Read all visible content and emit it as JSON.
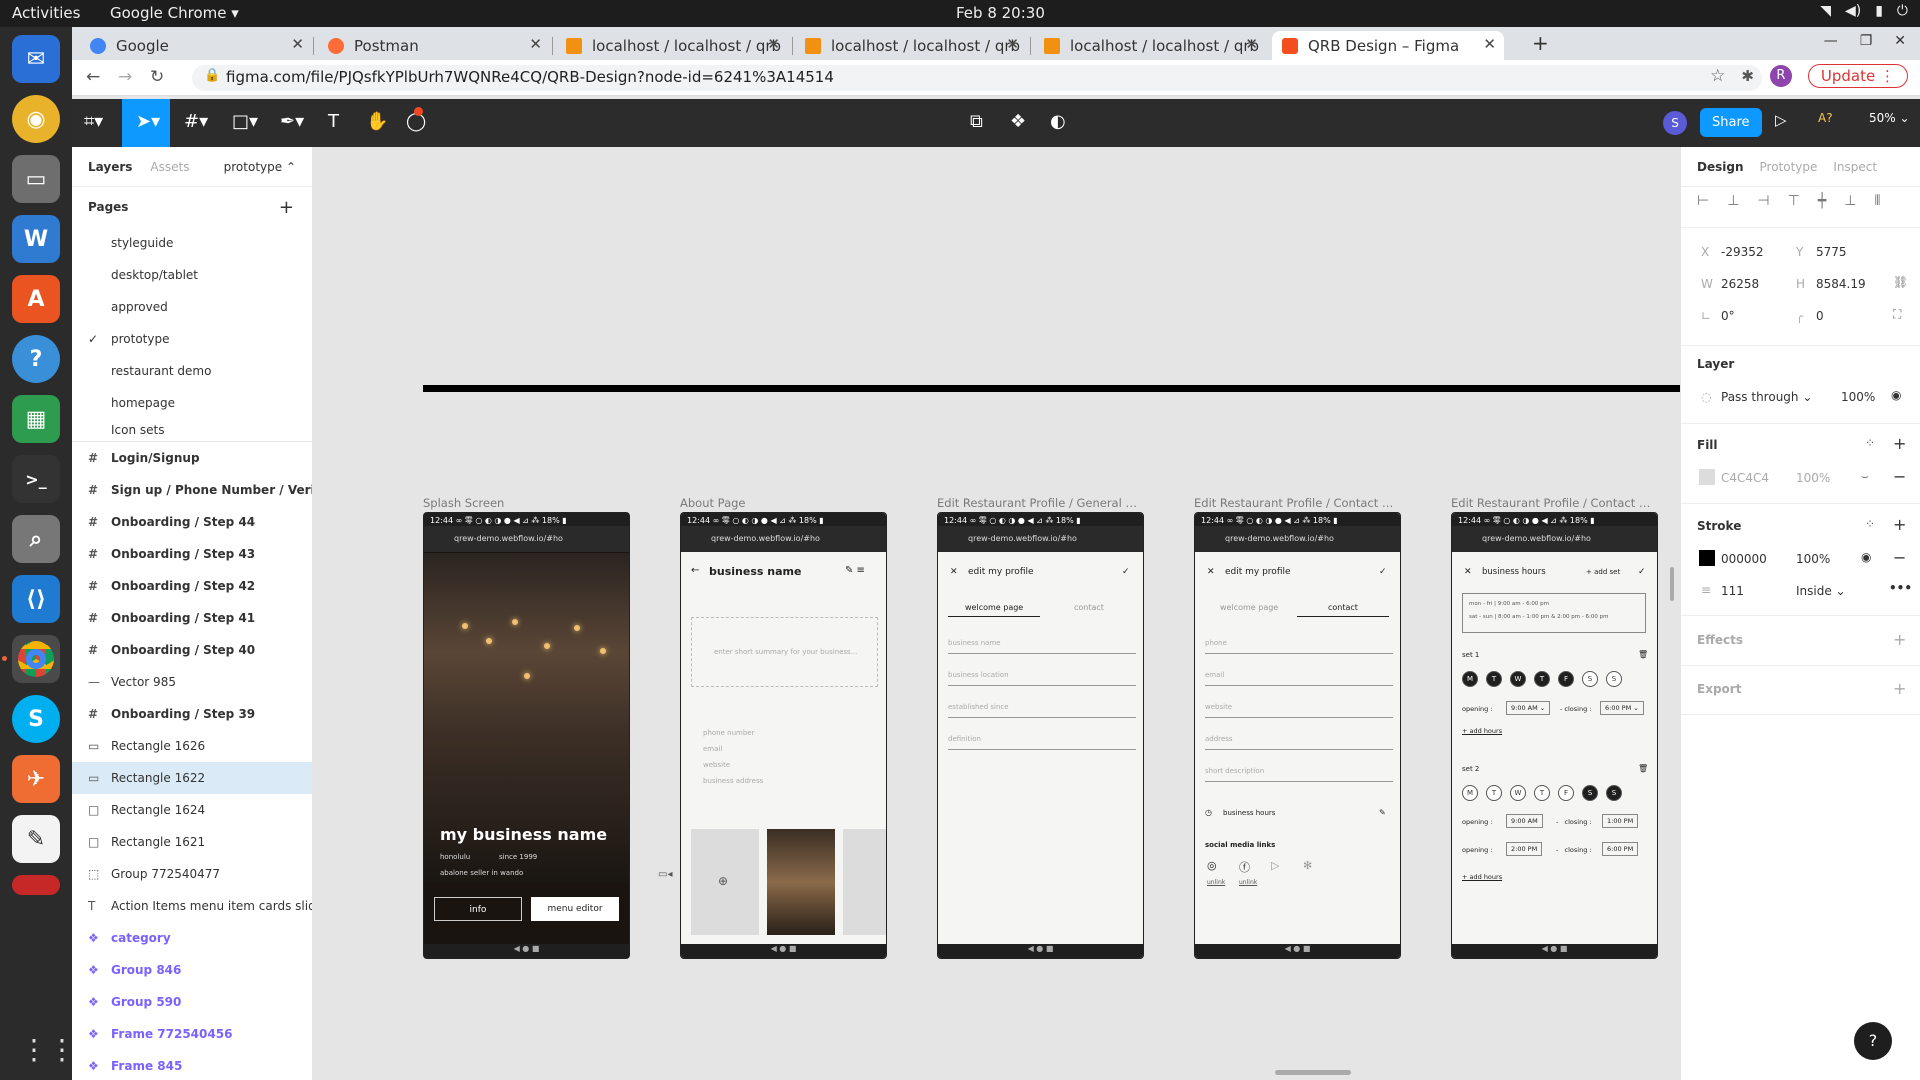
{
  "topbar": {
    "activities": "Activities",
    "app": "Google Chrome ▾",
    "clock": "Feb 8  20:30"
  },
  "tabs": [
    {
      "label": "Google",
      "color": "#4285f4"
    },
    {
      "label": "Postman",
      "color": "#ff6c37"
    },
    {
      "label": "localhost / localhost / qrb",
      "color": "#f29111"
    },
    {
      "label": "localhost / localhost / qrb",
      "color": "#f29111"
    },
    {
      "label": "localhost / localhost / qrb",
      "color": "#f29111"
    },
    {
      "label": "QRB Design – Figma",
      "color": "#f24e1e"
    }
  ],
  "address": {
    "url": "figma.com/file/PJQsfkYPlbUrh7WQNRe4CQ/QRB-Design?node-id=6241%3A14514",
    "update": "Update",
    "avatar": "R"
  },
  "figma": {
    "share": "Share",
    "zoom": "50%",
    "avatar": "S",
    "missing_fonts": "A?"
  },
  "left": {
    "tab_layers": "Layers",
    "tab_assets": "Assets",
    "page_picker": "prototype ⌃",
    "pages_title": "Pages",
    "pages": [
      "styleguide",
      "desktop/tablet",
      "approved",
      "prototype",
      "restaurant demo",
      "homepage",
      "Icon sets"
    ],
    "layers": [
      {
        "name": "Login/Signup",
        "type": "frame"
      },
      {
        "name": "Sign up / Phone Number / Verify",
        "type": "frame"
      },
      {
        "name": "Onboarding / Step 44",
        "type": "frame"
      },
      {
        "name": "Onboarding / Step 43",
        "type": "frame"
      },
      {
        "name": "Onboarding / Step 42",
        "type": "frame"
      },
      {
        "name": "Onboarding / Step 41",
        "type": "frame"
      },
      {
        "name": "Onboarding / Step 40",
        "type": "frame"
      },
      {
        "name": "Vector 985",
        "type": "vector"
      },
      {
        "name": "Onboarding / Step 39",
        "type": "frame"
      },
      {
        "name": "Rectangle 1626",
        "type": "rect"
      },
      {
        "name": "Rectangle 1622",
        "type": "rect"
      },
      {
        "name": "Rectangle 1624",
        "type": "rect"
      },
      {
        "name": "Rectangle 1621",
        "type": "rect"
      },
      {
        "name": "Group 772540477",
        "type": "group"
      },
      {
        "name": "Action Items menu item cards slidi...",
        "type": "text"
      },
      {
        "name": "category",
        "type": "comp"
      },
      {
        "name": "Group 846",
        "type": "comp"
      },
      {
        "name": "Group 590",
        "type": "comp"
      },
      {
        "name": "Frame 772540456",
        "type": "comp"
      },
      {
        "name": "Frame 845",
        "type": "comp"
      }
    ]
  },
  "canvas": {
    "frames": [
      {
        "label": "Splash Screen"
      },
      {
        "label": "About Page"
      },
      {
        "label": "Edit Restaurant Profile / General Det..."
      },
      {
        "label": "Edit Restaurant Profile / Contact Det..."
      },
      {
        "label": "Edit Restaurant Profile / Contact Det..."
      }
    ],
    "phone_status": "12:44 ∞ 零 ○ ◐ ◑ ●        ◀ ⊿ ⁂ 18% ▮",
    "phone_url": "qrew-demo.webflow.io/#ho",
    "splash": {
      "title": "my business name",
      "city": "honolulu",
      "since": "since 1999",
      "tag": "abalone seller in wando",
      "info": "info",
      "editor": "menu editor"
    },
    "about": {
      "name": "business name",
      "summary": "enter short summary for your business...",
      "fields": [
        "phone number",
        "email",
        "website",
        "business address"
      ]
    },
    "general": {
      "header": "edit my profile",
      "tab1": "welcome page",
      "tab2": "contact",
      "fields": [
        "business name",
        "business location",
        "established since",
        "definition"
      ]
    },
    "contact": {
      "header": "edit my profile",
      "tab1": "welcome page",
      "tab2": "contact",
      "fields": [
        "phone",
        "email",
        "website",
        "address",
        "short description"
      ],
      "hours": "business hours",
      "social": "social media links",
      "unlink": "unlink"
    },
    "hours": {
      "header": "business hours",
      "add": "+ add set",
      "row1": "mon - fri   |   9:00 am - 6:00 pm",
      "row2": "sat - sun   |   8:00 am - 1:00 pm   &   2:00 pm - 6:00 pm",
      "set1": "set 1",
      "set2": "set 2",
      "days": [
        "M",
        "T",
        "W",
        "T",
        "F",
        "S",
        "S"
      ],
      "opening": "opening :",
      "closing": "closing :",
      "o1": "9:00 AM",
      "c1": "6:00 PM",
      "o2": "9:00 AM",
      "c2": "1:00 PM",
      "o3": "2:00 PM",
      "c3": "6:00 PM",
      "addhours": "+ add hours"
    }
  },
  "right": {
    "tab_design": "Design",
    "tab_proto": "Prototype",
    "tab_inspect": "Inspect",
    "x": "-29352",
    "y": "5775",
    "w": "26258",
    "h": "8584.19",
    "rot": "0°",
    "radius": "0",
    "layer": "Layer",
    "blend": "Pass through ⌄",
    "opacity": "100%",
    "fill": "Fill",
    "fill_hex": "C4C4C4",
    "fill_op": "100%",
    "stroke": "Stroke",
    "stroke_hex": "000000",
    "stroke_op": "100%",
    "stroke_w": "111",
    "stroke_pos": "Inside ⌄",
    "effects": "Effects",
    "export": "Export"
  }
}
